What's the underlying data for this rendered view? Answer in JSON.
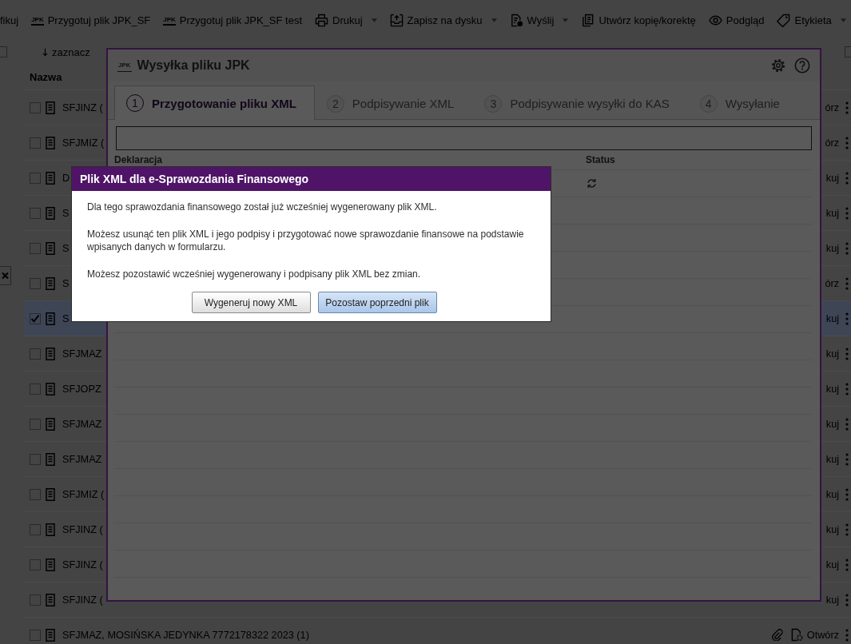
{
  "toolbar": {
    "items": [
      {
        "kind": "plain",
        "label": "fikuj",
        "dropdown": false
      },
      {
        "kind": "jpk",
        "icon_text": "JPK",
        "label": "Przygotuj plik JPK_SF",
        "dropdown": false
      },
      {
        "kind": "jpk",
        "icon_text": "JPK",
        "label": "Przygotuj plik JPK_SF test",
        "dropdown": false
      },
      {
        "kind": "print",
        "label": "Drukuj",
        "dropdown": true
      },
      {
        "kind": "save",
        "label": "Zapisz na dysku",
        "dropdown": true
      },
      {
        "kind": "send",
        "label": "Wyślij",
        "dropdown": true
      },
      {
        "kind": "copy",
        "label": "Utwórz kopię/korektę",
        "dropdown": false
      },
      {
        "kind": "preview",
        "label": "Podgląd",
        "dropdown": false
      },
      {
        "kind": "tag",
        "label": "Etykieta",
        "dropdown": true
      }
    ]
  },
  "list": {
    "select_label": "zaznacz",
    "column": "Nazwa",
    "rows": [
      {
        "name": "SFJINZ (",
        "action": "órz",
        "checked": false
      },
      {
        "name": "SFJMIZ (",
        "action": "órz",
        "checked": false
      },
      {
        "name": "D",
        "action": "kuj",
        "checked": false
      },
      {
        "name": "S",
        "action": "kuj",
        "checked": false
      },
      {
        "name": "S",
        "action": "kuj",
        "checked": false
      },
      {
        "name": "S",
        "action": "órz",
        "checked": false
      },
      {
        "name": "S",
        "action": "kuj",
        "checked": true
      },
      {
        "name": "SFJMAZ",
        "action": "kuj",
        "checked": false
      },
      {
        "name": "SFJOPZ",
        "action": "kuj",
        "checked": false
      },
      {
        "name": "SFJMAZ",
        "action": "kuj",
        "checked": false
      },
      {
        "name": "SFJMAZ",
        "action": "kuj",
        "checked": false
      },
      {
        "name": "SFJMIZ (",
        "action": "kuj",
        "checked": false
      },
      {
        "name": "SFJINZ (",
        "action": "kuj",
        "checked": false
      },
      {
        "name": "SFJINZ (",
        "action": "kuj",
        "checked": false
      },
      {
        "name": "SFJINZ (",
        "action": "kuj",
        "checked": false
      },
      {
        "name": "SFJMAZ, MOSIŃSKA JEDYNKA 7772178322 2023 (1)",
        "action": "Otwórz",
        "checked": false,
        "attachment": true,
        "action_icon": true
      }
    ]
  },
  "dialog": {
    "icon_text": "JPK",
    "title": "Wysyłka pliku JPK",
    "tabs": [
      {
        "number": "1",
        "label": "Przygotowanie pliku XML",
        "selected": true
      },
      {
        "number": "2",
        "label": "Podpisywanie XML",
        "selected": false
      },
      {
        "number": "3",
        "label": "Podpisywanie wysyłki do KAS",
        "selected": false
      },
      {
        "number": "4",
        "label": "Wysyłanie",
        "selected": false
      }
    ],
    "table": {
      "columns": [
        "Deklaracja",
        "Status"
      ],
      "rows": [
        {
          "kind": "loading"
        }
      ]
    }
  },
  "modal": {
    "title": "Plik XML dla e-Sprawozdania Finansowego",
    "paragraphs": [
      "Dla tego sprawozdania finansowego został już wcześniej wygenerowany plik XML.",
      "Możesz usunąć ten plik XML i jego podpisy i przygotować nowe sprawozdanie finansowe na podstawie wpisanych danych w formularzu.",
      "Możesz pozostawić wcześniej wygenerowany i podpisany plik XML bez zmian."
    ],
    "buttons": [
      {
        "label": "Wygeneruj nowy XML",
        "primary": false
      },
      {
        "label": "Pozostaw poprzedni plik",
        "primary": true
      }
    ]
  }
}
